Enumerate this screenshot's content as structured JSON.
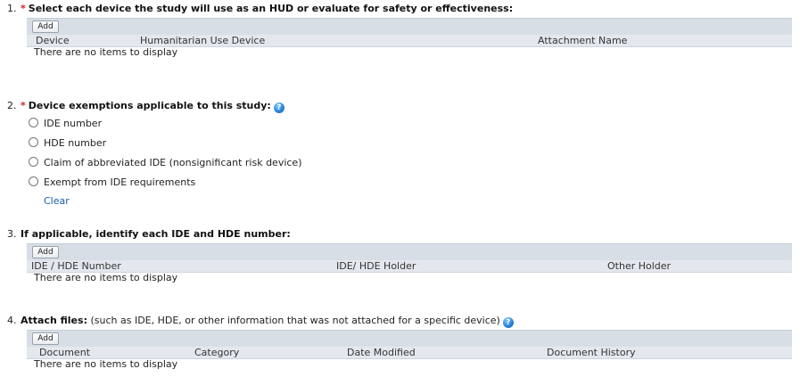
{
  "q1": {
    "num": "1.",
    "required_mark": "*",
    "label": "Select each device the study will use as an HUD or evaluate for safety or effectiveness:",
    "add_label": "Add",
    "columns": [
      "Device",
      "Humanitarian Use Device",
      "Attachment Name"
    ],
    "empty_text": "There are no items to display"
  },
  "q2": {
    "num": "2.",
    "required_mark": "*",
    "label": "Device exemptions applicable to this study:",
    "help_icon": "help-icon",
    "options": [
      "IDE number",
      "HDE number",
      "Claim of abbreviated IDE (nonsignificant risk device)",
      "Exempt from IDE requirements"
    ],
    "clear_label": "Clear"
  },
  "q3": {
    "num": "3.",
    "label": "If applicable, identify each IDE and HDE number:",
    "add_label": "Add",
    "columns": [
      "IDE / HDE Number",
      "IDE/ HDE Holder",
      "Other Holder"
    ],
    "empty_text": "There are no items to display"
  },
  "q4": {
    "num": "4.",
    "label": "Attach files:",
    "note": "(such as IDE, HDE, or other information that was not attached for a specific device)",
    "help_icon": "help-icon",
    "add_label": "Add",
    "columns": [
      "Document",
      "Category",
      "Date Modified",
      "Document History"
    ],
    "empty_text": "There are no items to display"
  },
  "colors": {
    "required": "#d62020",
    "toolbar_bg": "#d8dee6",
    "header_bg": "#e4e8ee",
    "link": "#1a5fa8",
    "help_icon": "#2b86d9"
  }
}
